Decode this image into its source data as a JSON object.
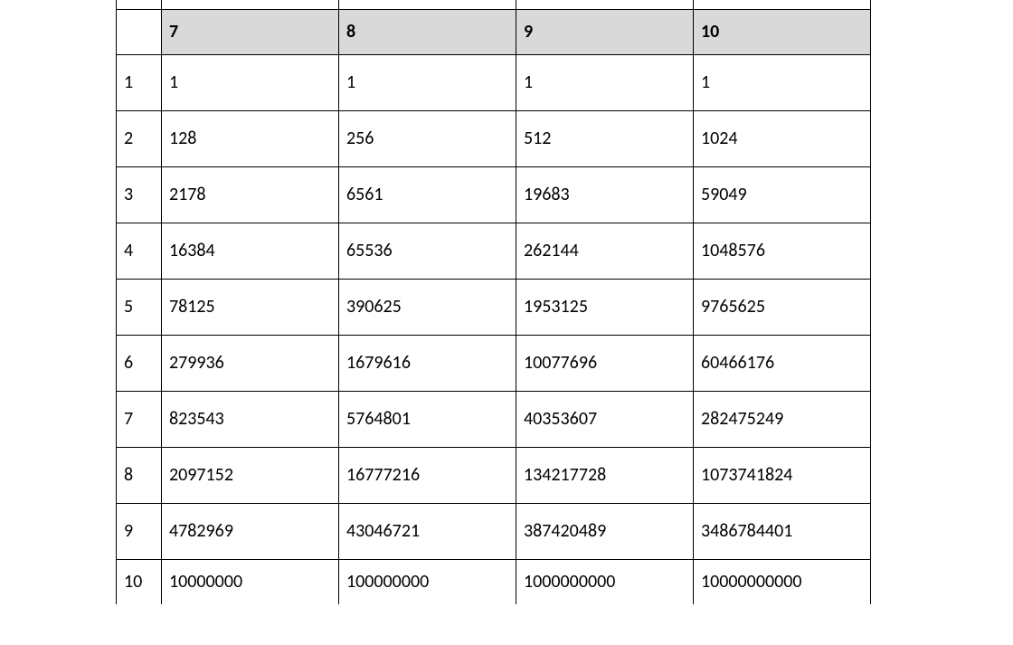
{
  "chart_data": {
    "type": "table",
    "columns": [
      "7",
      "8",
      "9",
      "10"
    ],
    "row_labels": [
      "1",
      "2",
      "3",
      "4",
      "5",
      "6",
      "7",
      "8",
      "9",
      "10"
    ],
    "rows": [
      [
        "1",
        "1",
        "1",
        "1"
      ],
      [
        "128",
        "256",
        "512",
        "1024"
      ],
      [
        "2178",
        "6561",
        "19683",
        "59049"
      ],
      [
        "16384",
        "65536",
        "262144",
        "1048576"
      ],
      [
        "78125",
        "390625",
        "1953125",
        "9765625"
      ],
      [
        "279936",
        "1679616",
        "10077696",
        "60466176"
      ],
      [
        "823543",
        "5764801",
        "40353607",
        "282475249"
      ],
      [
        "2097152",
        "16777216",
        "134217728",
        "1073741824"
      ],
      [
        "4782969",
        "43046721",
        "387420489",
        "3486784401"
      ],
      [
        "10000000",
        "100000000",
        "1000000000",
        "10000000000"
      ]
    ]
  }
}
